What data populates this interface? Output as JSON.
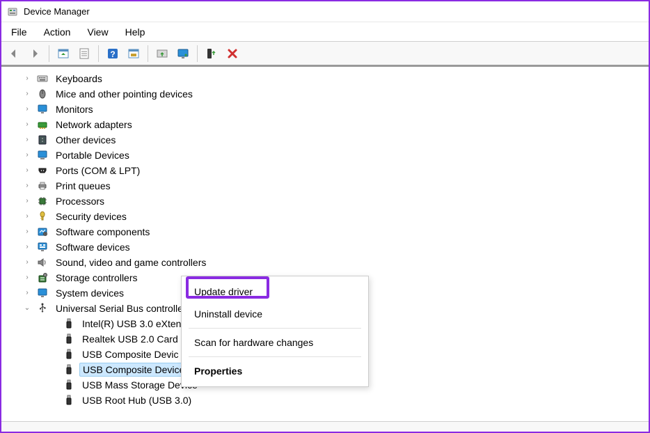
{
  "window": {
    "title": "Device Manager"
  },
  "menubar": {
    "file": "File",
    "action": "Action",
    "view": "View",
    "help": "Help"
  },
  "tree": {
    "categories": [
      {
        "label": "Keyboards",
        "icon": "keyboard",
        "expandable": true
      },
      {
        "label": "Mice and other pointing devices",
        "icon": "mouse",
        "expandable": true
      },
      {
        "label": "Monitors",
        "icon": "monitor",
        "expandable": true
      },
      {
        "label": "Network adapters",
        "icon": "network",
        "expandable": true
      },
      {
        "label": "Other devices",
        "icon": "other",
        "expandable": true
      },
      {
        "label": "Portable Devices",
        "icon": "portable",
        "expandable": true
      },
      {
        "label": "Ports (COM & LPT)",
        "icon": "port",
        "expandable": true
      },
      {
        "label": "Print queues",
        "icon": "printer",
        "expandable": true
      },
      {
        "label": "Processors",
        "icon": "processor",
        "expandable": true
      },
      {
        "label": "Security devices",
        "icon": "security",
        "expandable": true
      },
      {
        "label": "Software components",
        "icon": "softcomp",
        "expandable": true
      },
      {
        "label": "Software devices",
        "icon": "softdev",
        "expandable": true
      },
      {
        "label": "Sound, video and game controllers",
        "icon": "sound",
        "expandable": true
      },
      {
        "label": "Storage controllers",
        "icon": "storage",
        "expandable": true
      },
      {
        "label": "System devices",
        "icon": "system",
        "expandable": true
      },
      {
        "label": "Universal Serial Bus controllers",
        "icon": "usbctrl",
        "expandable": true,
        "expanded": true
      }
    ],
    "usb_children": [
      {
        "label": "Intel(R) USB 3.0 eXten",
        "icon": "usb"
      },
      {
        "label": "Realtek USB 2.0 Card",
        "icon": "usb"
      },
      {
        "label": "USB Composite Devic",
        "icon": "usb"
      },
      {
        "label": "USB Composite Device",
        "icon": "usb",
        "selected": true
      },
      {
        "label": "USB Mass Storage Device",
        "icon": "usb"
      },
      {
        "label": "USB Root Hub (USB 3.0)",
        "icon": "usb"
      }
    ]
  },
  "context_menu": {
    "update": "Update driver",
    "uninstall": "Uninstall device",
    "scan": "Scan for hardware changes",
    "properties": "Properties"
  }
}
